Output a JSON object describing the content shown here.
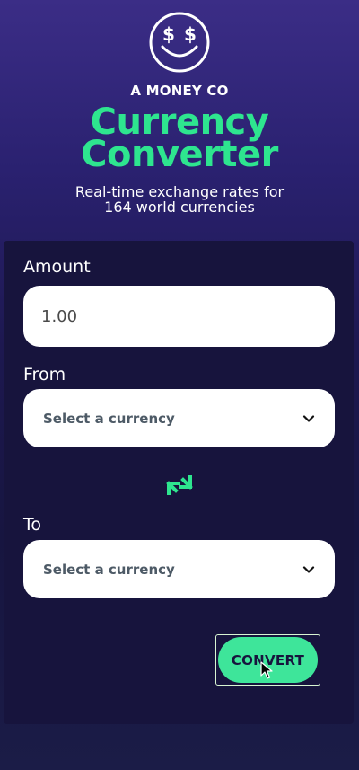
{
  "header": {
    "brand": "A MONEY CO",
    "title_line1": "Currency",
    "title_line2": "Converter",
    "subtitle_line1": "Real-time exchange rates for",
    "subtitle_line2": "164 world currencies",
    "logo_icon": "smiley-dollar-eyes-icon"
  },
  "form": {
    "amount_label": "Amount",
    "amount_value": "1.00",
    "from_label": "From",
    "from_selected": "Select a currency",
    "to_label": "To",
    "to_selected": "Select a currency",
    "swap_icon": "swap-arrows-icon",
    "convert_label": "CONVERT"
  },
  "colors": {
    "accent_green": "#2ee58f",
    "button_green": "#3ee59a",
    "card_bg": "#17143d",
    "header_bg": "#3b2d86"
  }
}
